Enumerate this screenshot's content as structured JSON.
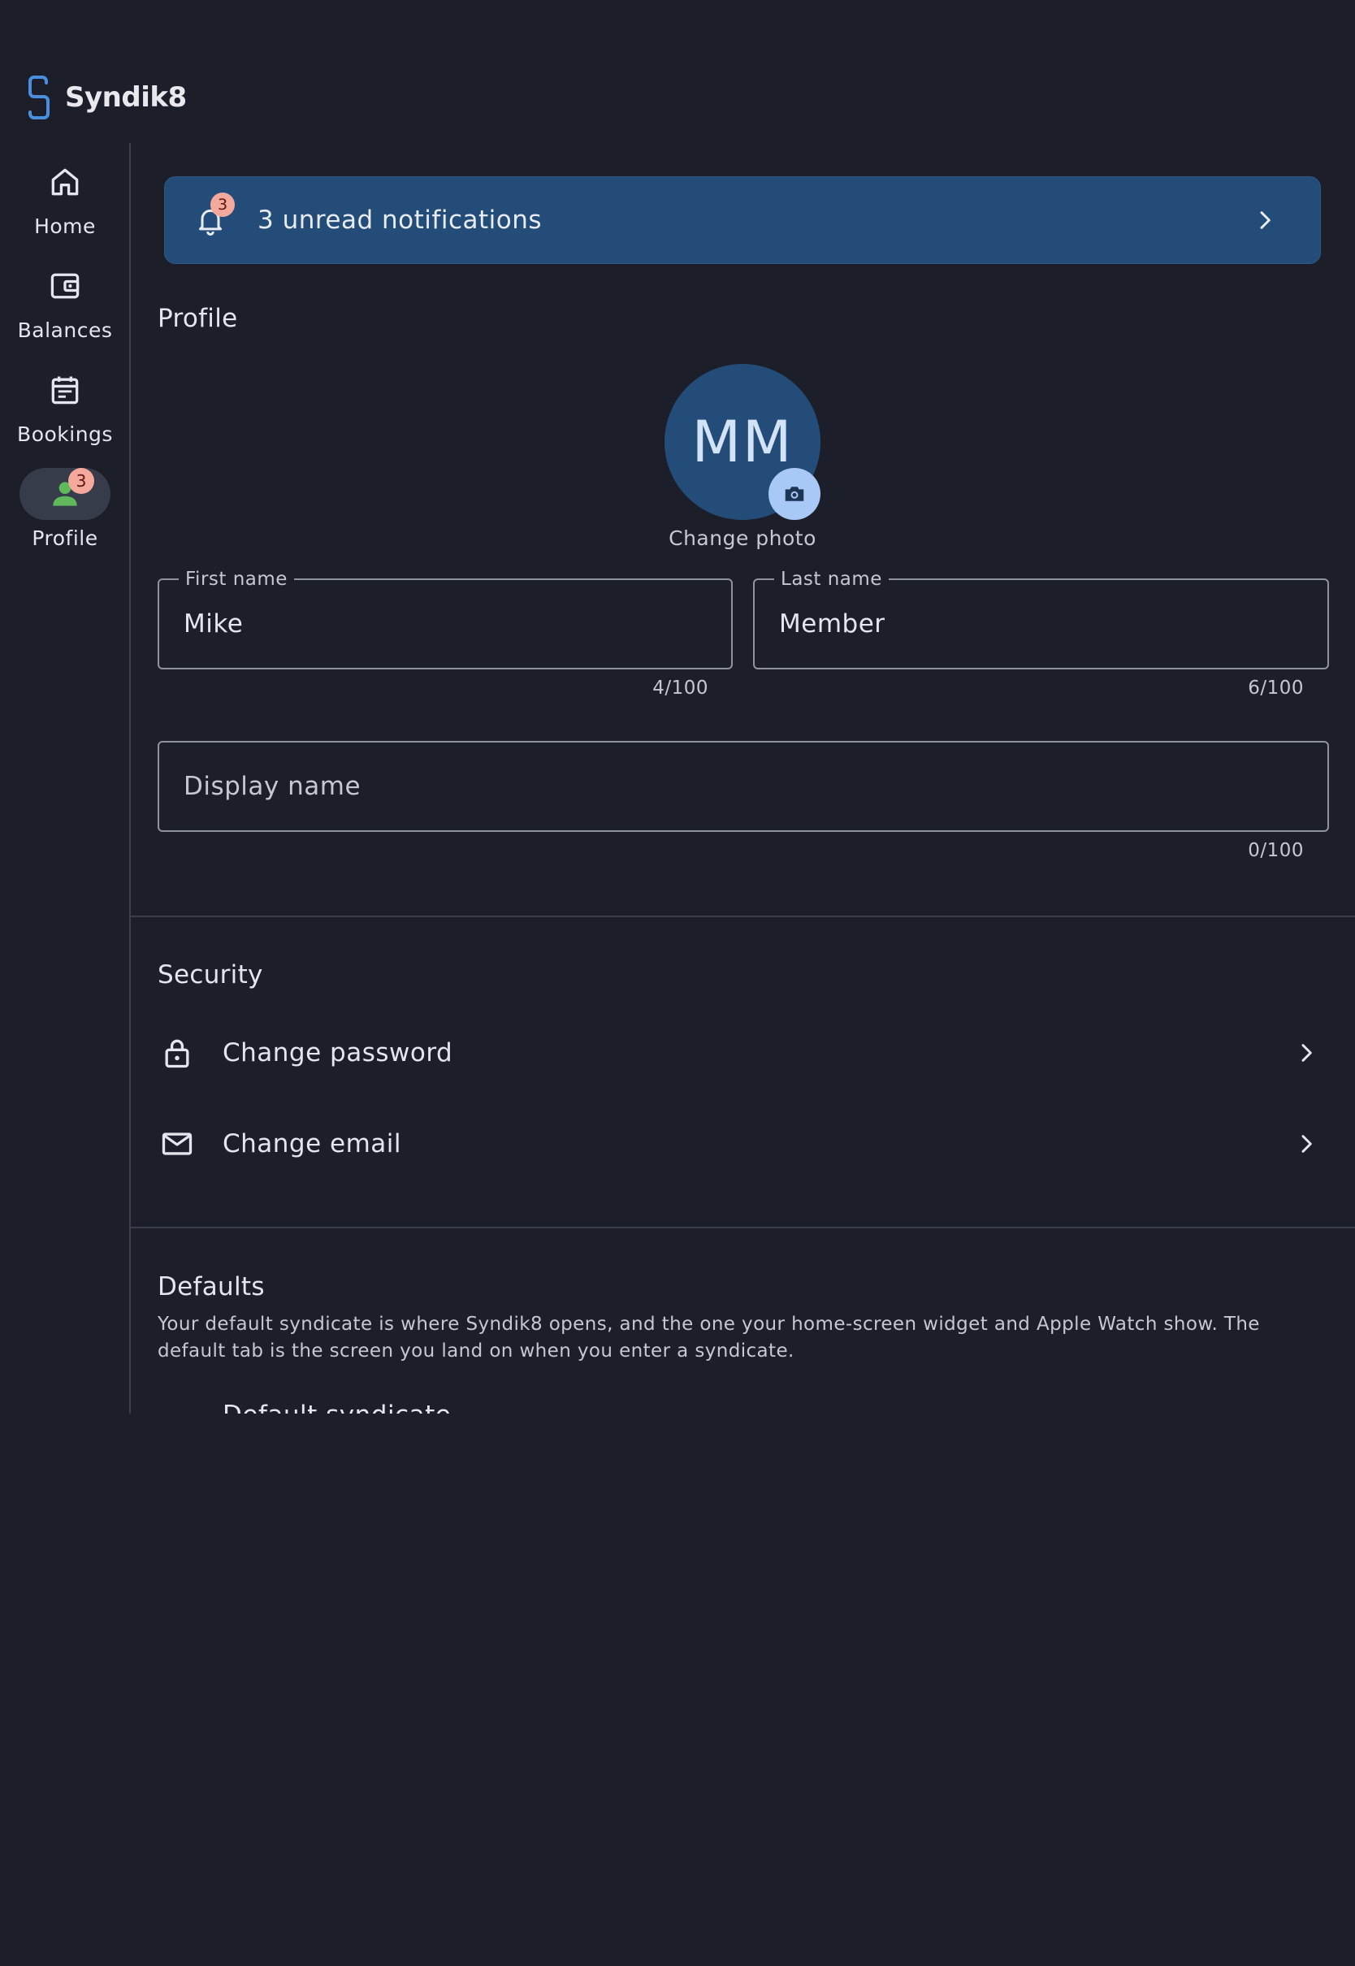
{
  "app": {
    "name": "Syndik8",
    "accent": "#4a8ee0"
  },
  "sidebar": {
    "items": [
      {
        "label": "Home",
        "icon": "home-icon"
      },
      {
        "label": "Balances",
        "icon": "wallet-icon"
      },
      {
        "label": "Bookings",
        "icon": "calendar-icon"
      },
      {
        "label": "Profile",
        "icon": "person-icon",
        "badge": "3",
        "active": true
      }
    ]
  },
  "notifications": {
    "badge": "3",
    "text": "3 unread notifications"
  },
  "profile": {
    "title": "Profile",
    "initials": "MM",
    "change_photo": "Change photo",
    "first_name": {
      "label": "First name",
      "value": "Mike",
      "counter": "4/100"
    },
    "last_name": {
      "label": "Last name",
      "value": "Member",
      "counter": "6/100"
    },
    "display_name": {
      "placeholder": "Display name",
      "counter": "0/100"
    }
  },
  "security": {
    "title": "Security",
    "items": [
      {
        "label": "Change password",
        "icon": "lock-icon"
      },
      {
        "label": "Change email",
        "icon": "mail-icon"
      }
    ]
  },
  "defaults": {
    "title": "Defaults",
    "description": "Your default syndicate is where Syndik8 opens, and the one your home-screen widget and Apple Watch show. The default tab is the screen you land on when you enter a syndicate.",
    "first_item_partial": "Default syndicate"
  }
}
